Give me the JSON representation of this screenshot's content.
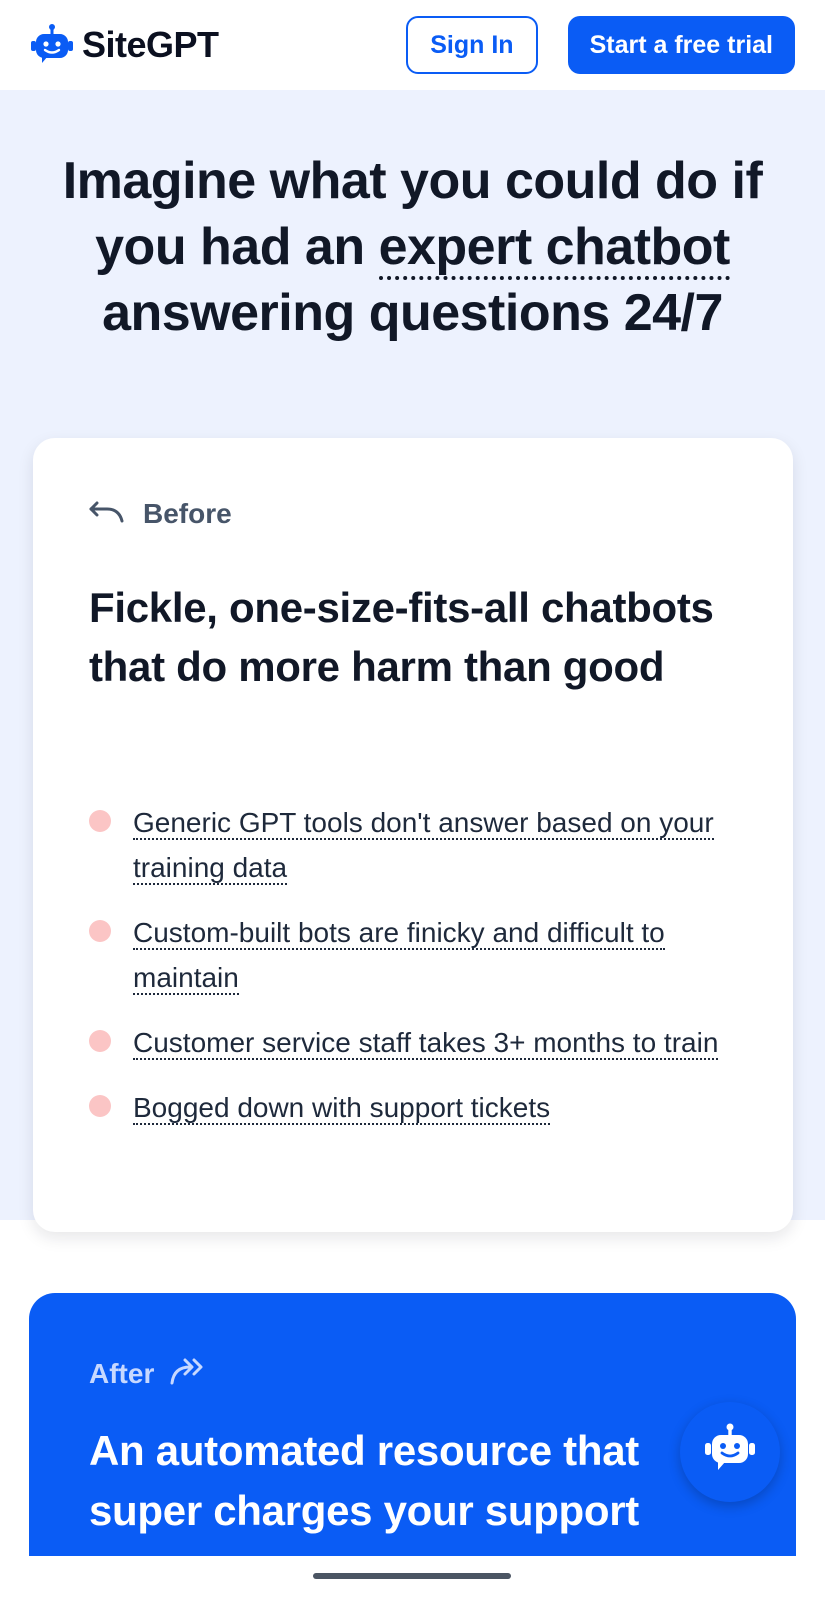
{
  "header": {
    "brand": "SiteGPT",
    "logo_icon": "robot-icon",
    "sign_in_label": "Sign In",
    "trial_label": "Start a free trial"
  },
  "hero": {
    "title_line1": "Imagine what you could do if",
    "title_line2_pre": "you had an ",
    "title_line2_emph": "expert chatbot",
    "title_line3": "answering questions 24/7"
  },
  "before": {
    "label": "Before",
    "icon": "undo-arrow-icon",
    "heading": "Fickle, one-size-fits-all chatbots that do more harm than good",
    "items": [
      "Generic GPT tools don't answer based on your training data",
      "Custom-built bots are finicky and difficult to maintain",
      "Customer service staff takes 3+ months to train",
      "Bogged down with support tickets"
    ],
    "bullet_color": "#fbc5c5"
  },
  "after": {
    "label": "After",
    "icon": "forward-arrows-icon",
    "heading": "An automated resource that super charges your support"
  },
  "chat": {
    "icon": "robot-chat-icon"
  },
  "colors": {
    "accent": "#0a5cf5",
    "hero_bg": "#edf2fe"
  }
}
